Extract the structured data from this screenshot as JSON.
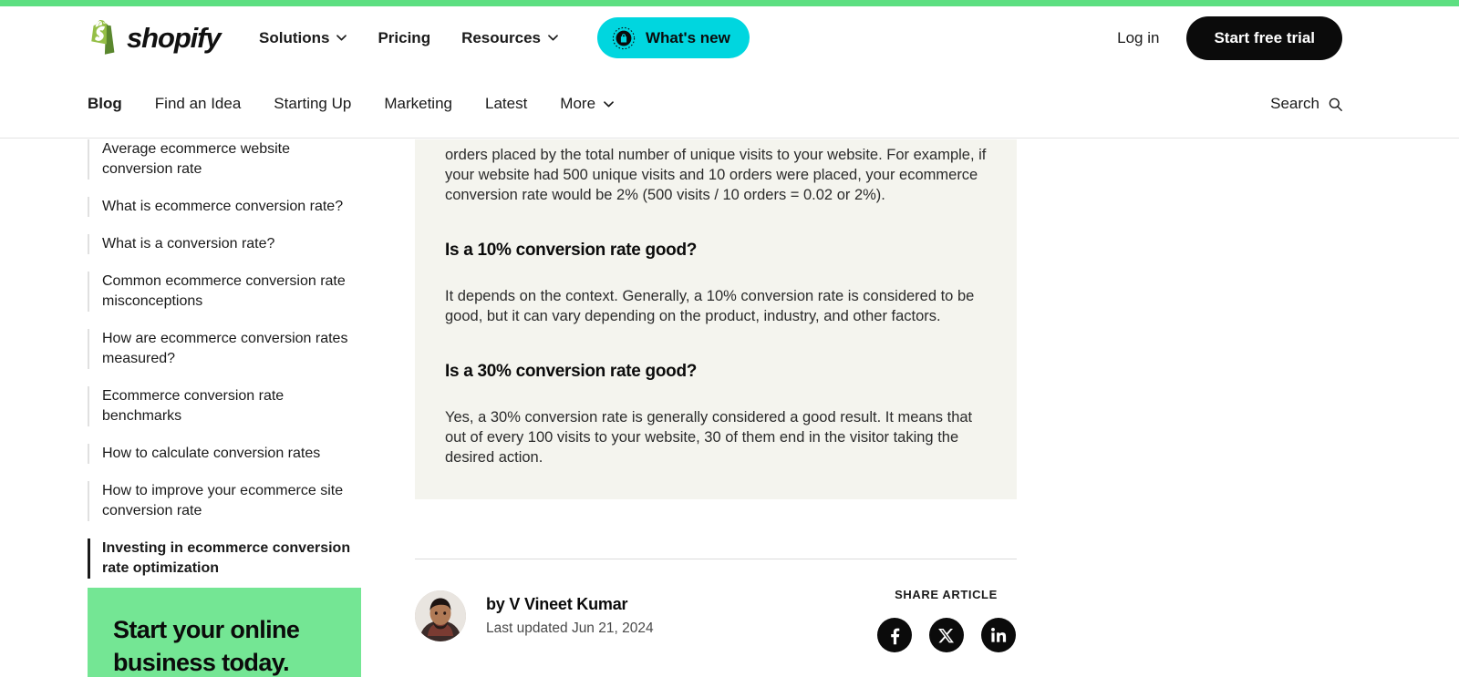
{
  "brand": {
    "name": "shopify",
    "logo_icon": "shopify-bag-icon",
    "accent_green": "#5ddf81",
    "cta_green": "#74e694",
    "whats_new_cyan": "#00d6df",
    "panel_cream": "#f4f4ee",
    "black": "#0b0b0b"
  },
  "header": {
    "nav": [
      {
        "label": "Solutions",
        "has_chevron": true
      },
      {
        "label": "Pricing",
        "has_chevron": false
      },
      {
        "label": "Resources",
        "has_chevron": true
      }
    ],
    "whats_new": {
      "label": "What's new",
      "icon": "shopify-badge-icon"
    },
    "login_label": "Log in",
    "trial_label": "Start free trial"
  },
  "subnav": {
    "items": [
      {
        "label": "Blog",
        "active": true,
        "has_chevron": false
      },
      {
        "label": "Find an Idea",
        "active": false,
        "has_chevron": false
      },
      {
        "label": "Starting Up",
        "active": false,
        "has_chevron": false
      },
      {
        "label": "Marketing",
        "active": false,
        "has_chevron": false
      },
      {
        "label": "Latest",
        "active": false,
        "has_chevron": false
      },
      {
        "label": "More",
        "active": false,
        "has_chevron": true
      }
    ],
    "search": {
      "label": "Search",
      "icon": "search-icon"
    }
  },
  "sidebar": {
    "toc": [
      {
        "label": "Average ecommerce website conversion rate",
        "active": false
      },
      {
        "label": "What is ecommerce conversion rate?",
        "active": false
      },
      {
        "label": "What is a conversion rate?",
        "active": false
      },
      {
        "label": "Common ecommerce conversion rate misconceptions",
        "active": false
      },
      {
        "label": "How are ecommerce conversion rates measured?",
        "active": false
      },
      {
        "label": "Ecommerce conversion rate benchmarks",
        "active": false
      },
      {
        "label": "How to calculate conversion rates",
        "active": false
      },
      {
        "label": "How to improve your ecommerce site conversion rate",
        "active": false
      },
      {
        "label": "Investing in ecommerce conversion rate optimization",
        "active": true
      }
    ],
    "cta": {
      "title": "Start your online business today."
    }
  },
  "article": {
    "faq_intro": "orders placed by the total number of unique visits to your website. For example, if your website had 500 unique visits and 10 orders were placed, your ecommerce conversion rate would be 2% (500 visits / 10 orders = 0.02 or 2%).",
    "faqs": [
      {
        "question": "Is a 10% conversion rate good?",
        "answer": "It depends on the context. Generally, a 10% conversion rate is considered to be good, but it can vary depending on the product, industry, and other factors."
      },
      {
        "question": "Is a 30% conversion rate good?",
        "answer": "Yes, a 30% conversion rate is generally considered a good result. It means that out of every 100 visits to your website, 30 of them end in the visitor taking the desired action."
      }
    ],
    "byline": {
      "author_prefix": "by ",
      "author_name": "V Vineet Kumar",
      "author_full": "by V Vineet Kumar",
      "last_updated": "Last updated Jun 21, 2024",
      "avatar": "author-avatar"
    },
    "share": {
      "title": "SHARE ARTICLE",
      "icons": [
        {
          "name": "facebook-icon"
        },
        {
          "name": "x-twitter-icon"
        },
        {
          "name": "linkedin-icon"
        }
      ]
    }
  }
}
